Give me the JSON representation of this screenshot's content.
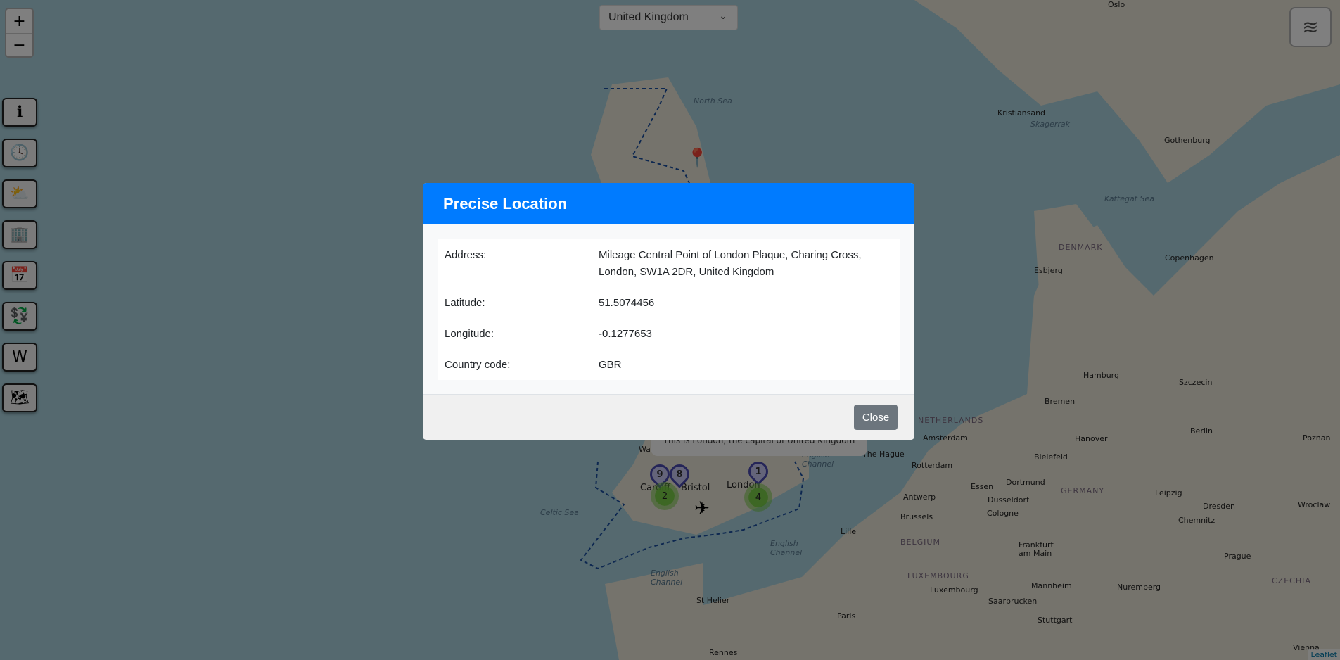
{
  "map": {
    "country_select": "United Kingdom",
    "zoom_in": "+",
    "zoom_out": "−",
    "side_buttons": [
      {
        "name": "info-icon",
        "glyph": "ℹ"
      },
      {
        "name": "clock-icon",
        "glyph": "🕓"
      },
      {
        "name": "weather-icon",
        "glyph": "⛅"
      },
      {
        "name": "buildings-icon",
        "glyph": "🏢"
      },
      {
        "name": "calendar-icon",
        "glyph": "📅"
      },
      {
        "name": "currency-exchange-icon",
        "glyph": "💱"
      },
      {
        "name": "wikipedia-icon",
        "glyph": "W"
      },
      {
        "name": "map-pin-icon",
        "glyph": "🗺"
      }
    ],
    "layers_icon": "layers-icon",
    "attribution": "Leaflet",
    "labels": {
      "north_sea": "North Sea",
      "oslo": "Oslo",
      "kristiansand": "Kristiansand",
      "skagerrak": "Skagerrak",
      "gothenburg": "Gothenburg",
      "kattegat": "Kattegat Sea",
      "denmark": "DENMARK",
      "esbjerg": "Esbjerg",
      "copenhagen": "Copenhagen",
      "hamburg": "Hamburg",
      "szczecin": "Szczecin",
      "bremen": "Bremen",
      "netherlands": "NETHERLANDS",
      "amsterdam": "Amsterdam",
      "hanover": "Hanover",
      "berlin": "Berlin",
      "poznan": "Poznan",
      "the_hague": "The Hague",
      "rotterdam": "Rotterdam",
      "bielefeld": "Bielefeld",
      "essen": "Essen",
      "dortmund": "Dortmund",
      "germany": "GERMANY",
      "leipzig": "Leipzig",
      "dresden": "Dresden",
      "antwerp": "Antwerp",
      "dusseldorf": "Dusseldorf",
      "cologne": "Cologne",
      "chemnitz": "Chemnitz",
      "wroclaw": "Wroclaw",
      "brussels": "Brussels",
      "lille": "Lille",
      "belgium": "BELGIUM",
      "frankfurt": "Frankfurt am Main",
      "prague": "Prague",
      "luxembourg_c": "LUXEMBOURG",
      "czechia": "CZECHIA",
      "luxembourg": "Luxembourg",
      "mannheim": "Mannheim",
      "nuremberg": "Nuremberg",
      "saarbrucken": "Saarbrucken",
      "stuttgart": "Stuttgart",
      "paris": "Paris",
      "st_helier": "St Helier",
      "rennes": "Rennes",
      "vienna": "Vienna",
      "celtic_sea": "Celtic Sea",
      "english_channel": "English Channel",
      "bristol": "Bristol",
      "london": "London",
      "wales": "Wales",
      "cardiff": "Cardiff"
    },
    "markers": {
      "pin_a": "9",
      "pin_b": "8",
      "cluster_a": "2",
      "pin_c": "1",
      "cluster_b": "4"
    },
    "popup": "This is London, the capital of United Kingdom"
  },
  "modal": {
    "title": "Precise Location",
    "rows": [
      {
        "label": "Address:",
        "value": "Mileage Central Point of London Plaque, Charing Cross, London, SW1A 2DR, United Kingdom"
      },
      {
        "label": "Latitude:",
        "value": "51.5074456"
      },
      {
        "label": "Longitude:",
        "value": "-0.1277653"
      },
      {
        "label": "Country code:",
        "value": "GBR"
      }
    ],
    "close_label": "Close"
  },
  "colors": {
    "header": "#007bff",
    "close_button": "#6c757d"
  }
}
